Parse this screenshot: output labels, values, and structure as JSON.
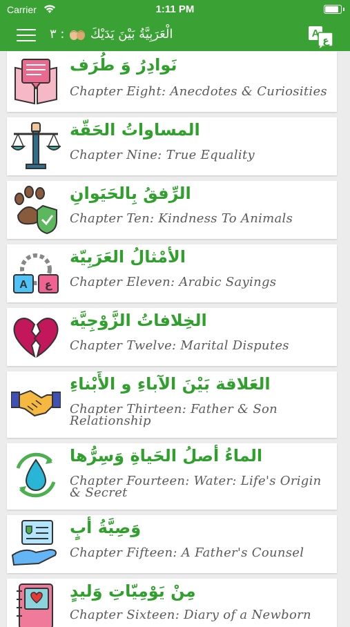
{
  "status_bar": {
    "carrier": "Carrier",
    "time": "1:11 PM",
    "battery_level": 1.0
  },
  "nav": {
    "title": "الْعَرَبِيَّةُ بَيْنَ يَدَيْكَ 🤲🏽: ٣",
    "title_text": "الْعَرَبِيَّةُ بَيْنَ يَدَيْكَ",
    "title_num": ": ٣",
    "lang_icon": "translate-icon",
    "menu_icon": "hamburger-menu-icon"
  },
  "colors": {
    "accent": "#3aa234",
    "arabic_title": "#2fa02c",
    "english_sub": "#5a5a5a"
  },
  "chapters": [
    {
      "ar": "نَوادِرُ وَ طُرَف",
      "en": "Chapter Eight: Anecdotes & Curiosities",
      "icon": "book-icon"
    },
    {
      "ar": "المساواتُ الحَقّة",
      "en": "Chapter Nine: True Equality",
      "icon": "scales-icon"
    },
    {
      "ar": "الرِّفقُ بِالحَيَوانِ",
      "en": "Chapter Ten: Kindness To Animals",
      "icon": "paw-shield-icon"
    },
    {
      "ar": "الأمْثالُ العَرَبِيّة",
      "en": "Chapter Eleven: Arabic Sayings",
      "icon": "language-gear-icon"
    },
    {
      "ar": "الخِلافاتُ الزَّوْجِيَّة",
      "en": "Chapter Twelve: Marital Disputes",
      "icon": "broken-heart-icon"
    },
    {
      "ar": "العَلاقة بَيْنَ الآباءِ و الأَبْناءِ",
      "en": "Chapter Thirteen: Father & Son Relationship",
      "icon": "handshake-icon"
    },
    {
      "ar": "الماءُ أصلُ الحَياةِ وَسِرُّها",
      "en": "Chapter Fourteen: Water: Life's Origin & Secret",
      "icon": "water-drop-icon"
    },
    {
      "ar": "وَصِيَّةُ أبٍ",
      "en": "Chapter Fifteen: A Father's Counsel",
      "icon": "hand-document-icon"
    },
    {
      "ar": "مِنْ يَوْمِيّاتِ وَليدٍ",
      "en": "Chapter Sixteen: Diary of a Newborn",
      "icon": "diary-icon"
    }
  ]
}
